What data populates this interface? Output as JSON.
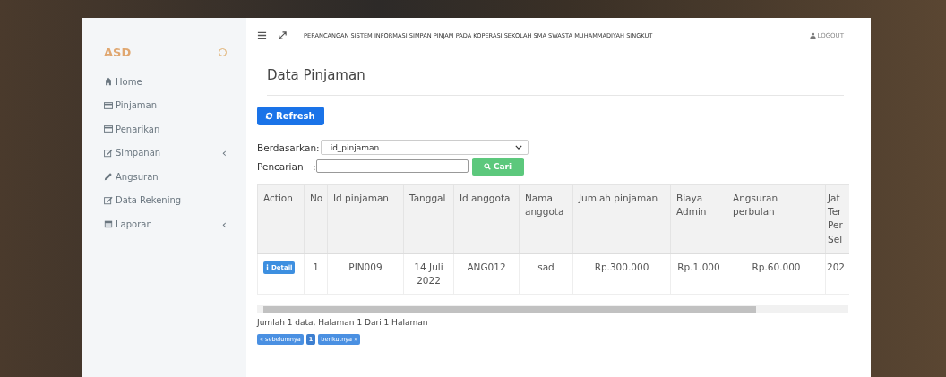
{
  "sidebar": {
    "brand": "ASD",
    "items": [
      {
        "label": "Home"
      },
      {
        "label": "Pinjaman"
      },
      {
        "label": "Penarikan"
      },
      {
        "label": "Simpanan",
        "chevron": "‹"
      },
      {
        "label": "Angsuran"
      },
      {
        "label": "Data Rekening"
      },
      {
        "label": "Laporan",
        "chevron": "‹"
      }
    ]
  },
  "topbar": {
    "title": "PERANCANGAN SISTEM INFORMASI SIMPAN PINJAM PADA KOPERASI SEKOLAH SMA SWASTA MUHAMMADIYAH SINGKUT",
    "logout": "LOGOUT"
  },
  "page_title": "Data Pinjaman",
  "refresh_button": "Refresh",
  "filter": {
    "label": "Berdasarkan:",
    "value": "id_pinjaman"
  },
  "search": {
    "label": "Pencarian",
    "separator": ":",
    "button": "Cari"
  },
  "table": {
    "columns": [
      "Action",
      "No",
      "Id pinjaman",
      "Tanggal",
      "Id anggota",
      "Nama anggota",
      "Jumlah pinjaman",
      "Biaya Admin",
      "Angsuran perbulan",
      "Jat Ter Per Sel"
    ],
    "rows": [
      {
        "cells": [
          "Detail",
          "1",
          "PIN009",
          "14 Juli 2022",
          "ANG012",
          "sad",
          "Rp.300.000",
          "Rp.1.000",
          "Rp.60.000",
          "202"
        ]
      }
    ]
  },
  "summary": "Jumlah 1 data, Halaman 1 Dari 1 Halaman",
  "pagination": [
    {
      "label": "« sebelumnya",
      "selected": false
    },
    {
      "label": "1",
      "selected": true
    },
    {
      "label": "berikutnya »",
      "selected": false
    }
  ]
}
